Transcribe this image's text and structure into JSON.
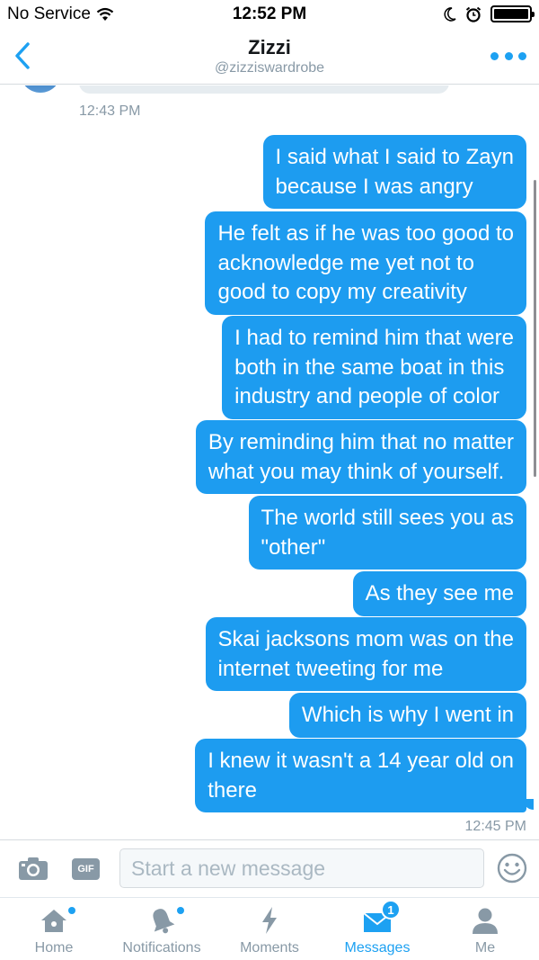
{
  "status_bar": {
    "carrier": "No Service",
    "time": "12:52 PM"
  },
  "header": {
    "name": "Zizzi",
    "handle": "@zizziswardrobe"
  },
  "thread": {
    "previous_timestamp": "12:43 PM",
    "messages": [
      "I said what I said to Zayn\nbecause I was angry",
      "He felt as if he was too good to\nacknowledge me yet not to\ngood to copy my creativity",
      "I had to remind him that were\nboth in the same boat in this\nindustry and people of color",
      "By reminding him that no matter\nwhat you may think of yourself.",
      "The world still sees you as\n\"other\"",
      "As they see me",
      "Skai jacksons mom was on the\ninternet tweeting for me",
      "Which is why I went in",
      "I knew it wasn't a 14 year old on\nthere"
    ],
    "last_timestamp": "12:45 PM"
  },
  "composer": {
    "gif_label": "GIF",
    "placeholder": "Start a new message"
  },
  "tabbar": {
    "tabs": [
      {
        "label": "Home",
        "icon": "home-icon",
        "indicator": "dot"
      },
      {
        "label": "Notifications",
        "icon": "bell-icon",
        "indicator": "dot"
      },
      {
        "label": "Moments",
        "icon": "lightning-icon",
        "indicator": ""
      },
      {
        "label": "Messages",
        "icon": "envelope-icon",
        "indicator": "1",
        "active": true
      },
      {
        "label": "Me",
        "icon": "person-icon",
        "indicator": ""
      }
    ]
  },
  "colors": {
    "accent": "#1da1f2",
    "bubble": "#1d9cf0",
    "muted": "#8899a6"
  }
}
